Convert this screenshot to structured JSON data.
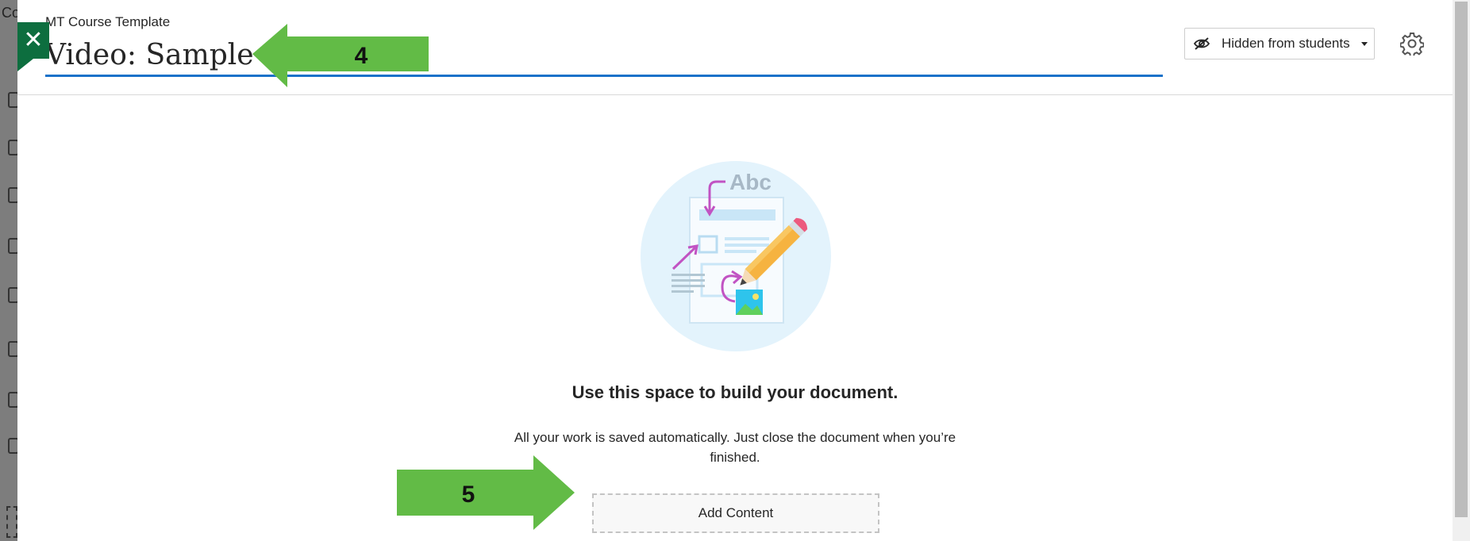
{
  "background": {
    "text": "Co"
  },
  "header": {
    "close_label": "✕",
    "course_name": "MT Course Template",
    "title_value": "Video: Sample",
    "visibility_label": "Hidden from students",
    "icons": [
      "close-icon",
      "eye-slash-icon",
      "caret-down-icon",
      "gear-icon"
    ]
  },
  "empty_state": {
    "illustration_text": "Abc",
    "title": "Use this space to build your document.",
    "description": "All your work is saved automatically. Just close the document when you’re finished.",
    "add_content_label": "Add Content"
  },
  "annotations": [
    {
      "number": "4"
    },
    {
      "number": "5"
    }
  ],
  "colors": {
    "accent": "#1b72c9",
    "close_green": "#0d6e3f",
    "arrow_green": "#62bb46"
  }
}
